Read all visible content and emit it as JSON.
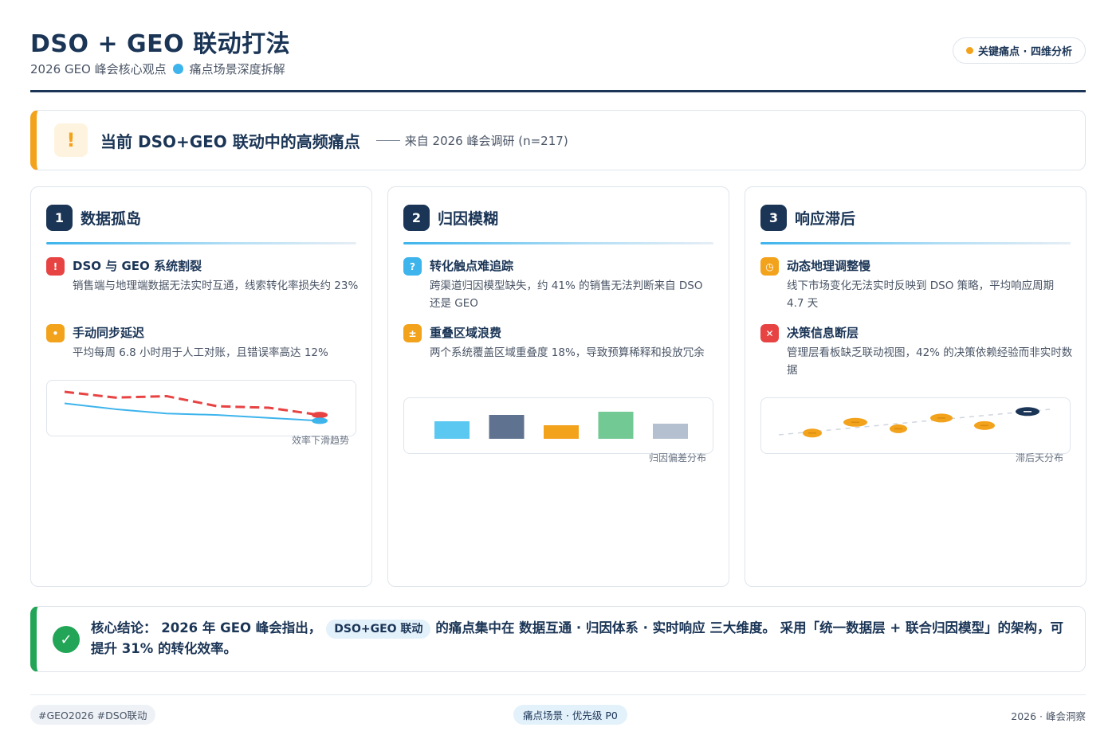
{
  "header": {
    "title": "DSO + GEO 联动打法",
    "subtitle_left": "2026 GEO 峰会核心观点",
    "subtitle_right": "痛点场景深度拆解",
    "badge": "关键痛点 · 四维分析"
  },
  "alert": {
    "icon": "!",
    "title": "当前 DSO+GEO 联动中的高频痛点",
    "source": "来自 2026 峰会调研 (n=217)"
  },
  "cards": [
    {
      "num": "1",
      "title": "数据孤岛",
      "items": [
        {
          "icon": "!",
          "title": "DSO 与 GEO 系统割裂",
          "desc": "销售端与地理端数据无法实时互通，线索转化率损失约 23%"
        },
        {
          "icon": "•",
          "title": "手动同步延迟",
          "desc": "平均每周 6.8 小时用于人工对账，且错误率高达 12%"
        }
      ],
      "caption": "效率下滑趋势"
    },
    {
      "num": "2",
      "title": "归因模糊",
      "items": [
        {
          "icon": "?",
          "title": "转化触点难追踪",
          "desc": "跨渠道归因模型缺失，约 41% 的销售无法判断来自 DSO 还是 GEO"
        },
        {
          "icon": "±",
          "title": "重叠区域浪费",
          "desc": "两个系统覆盖区域重叠度 18%，导致预算稀释和投放冗余"
        }
      ],
      "caption": "归因偏差分布"
    },
    {
      "num": "3",
      "title": "响应滞后",
      "items": [
        {
          "icon": "◷",
          "title": "动态地理调整慢",
          "desc": "线下市场变化无法实时反映到 DSO 策略，平均响应周期 4.7 天"
        },
        {
          "icon": "✕",
          "title": "决策信息断层",
          "desc": "管理层看板缺乏联动视图，42% 的决策依赖经验而非实时数据"
        }
      ],
      "caption": "滞后天分布"
    }
  ],
  "conclusion": {
    "icon": "✓",
    "part1": "核心结论： 2026 年 GEO 峰会指出，",
    "pill": "DSO+GEO 联动",
    "part2": "的痛点集中在 数据互通 · 归因体系 · 实时响应 三大维度。 采用「统一数据层 + 联合归因模型」的架构，可提升 31% 的转化效率。"
  },
  "footer": {
    "tags": "#GEO2026 #DSO联动",
    "middle": "痛点场景 · 优先级 P0",
    "right": "2026 · 峰会洞察"
  },
  "colors": {
    "navy": "#1b3556",
    "accent_blue": "#3db4ec",
    "warning_orange": "#f3a21c",
    "danger_red": "#e84343",
    "success_green": "#22a556"
  },
  "chart_data": [
    {
      "type": "line",
      "caption": "效率下滑趋势",
      "series": [
        {
          "values": [
            100,
            96,
            97,
            90,
            89,
            84
          ]
        },
        {
          "values": [
            92,
            88,
            85,
            84,
            82,
            80
          ]
        }
      ]
    },
    {
      "type": "bar",
      "caption": "归因偏差分布",
      "values": [
        22,
        30,
        17,
        34,
        19
      ]
    },
    {
      "type": "scatter",
      "caption": "滞后天分布",
      "values": [
        1.2,
        2.2,
        1.6,
        2.6,
        1.9,
        3.2
      ]
    }
  ]
}
